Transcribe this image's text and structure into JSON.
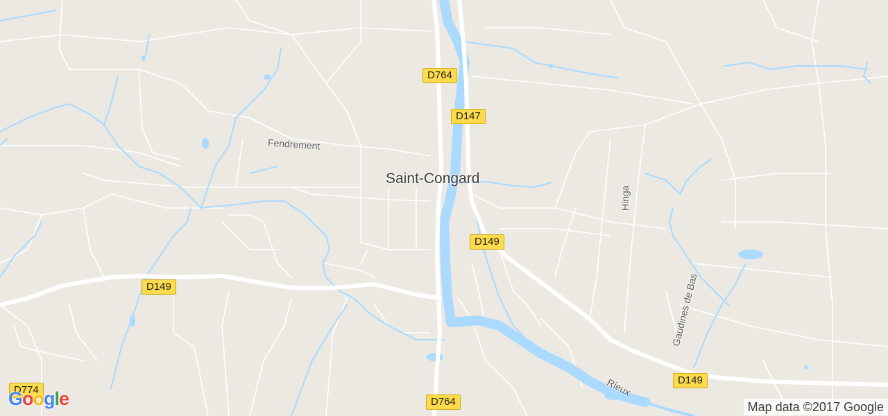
{
  "map": {
    "place_labels": {
      "town": "Saint-Congard",
      "fendrement": "Fendrement",
      "hinga": "Hinga",
      "gaudines": "Gaudines de Bas",
      "rieux": "Rieux"
    },
    "road_shields": {
      "d764_top": "D764",
      "d147": "D147",
      "d149_east": "D149",
      "d149_west": "D149",
      "d149_southeast": "D149",
      "d764_bottom": "D764",
      "d774": "D774"
    },
    "colors": {
      "land": "#ebe9e2",
      "water": "#aadaff",
      "road": "#ffffff",
      "shield": "#fddb4a"
    }
  },
  "logo": {
    "letters": [
      "G",
      "o",
      "o",
      "g",
      "l",
      "e"
    ],
    "colors": [
      "#4285f4",
      "#ea4335",
      "#fbbc05",
      "#4285f4",
      "#34a853",
      "#ea4335"
    ]
  },
  "attribution": "Map data ©2017 Google"
}
